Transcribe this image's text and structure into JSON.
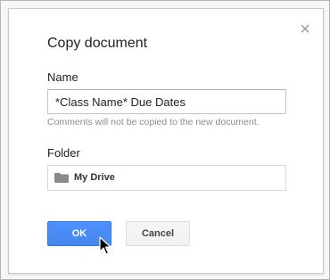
{
  "dialog": {
    "title": "Copy document",
    "close_icon": "close-icon"
  },
  "name": {
    "label": "Name",
    "value": "*Class Name* Due Dates",
    "hint": "Comments will not be copied to the new document."
  },
  "folder": {
    "label": "Folder",
    "icon": "folder-icon",
    "value": "My Drive"
  },
  "buttons": {
    "ok_label": "OK",
    "cancel_label": "Cancel"
  },
  "colors": {
    "accent": "#4d90fe",
    "hint_text": "#8c8c8c"
  }
}
